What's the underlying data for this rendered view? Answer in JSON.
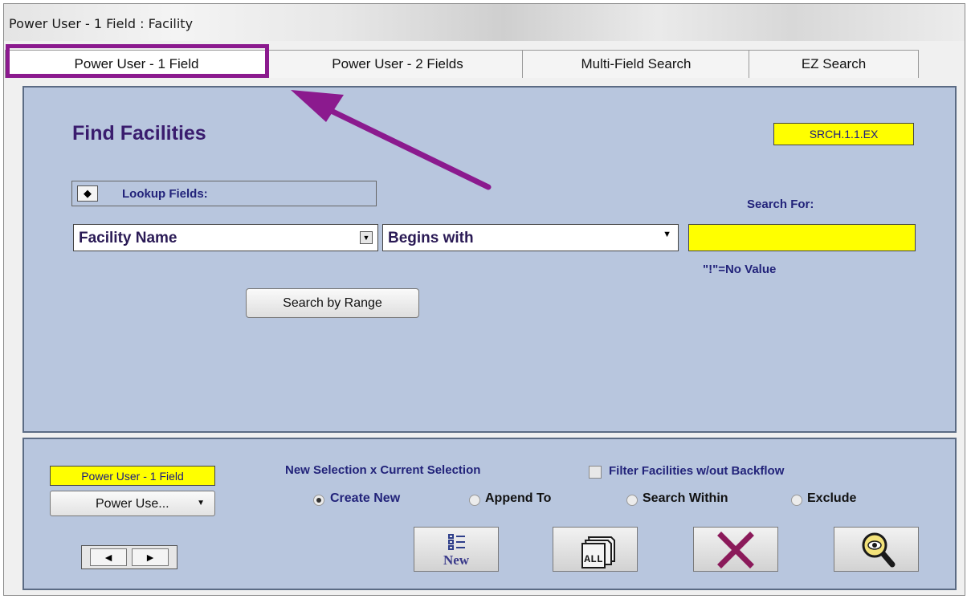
{
  "window": {
    "title": "Power User - 1 Field : Facility"
  },
  "tabs": [
    {
      "label": "Power User - 1 Field"
    },
    {
      "label": "Power User - 2 Fields"
    },
    {
      "label": "Multi-Field Search"
    },
    {
      "label": "EZ Search"
    }
  ],
  "main": {
    "title": "Find Facilities",
    "code": "SRCH.1.1.EX",
    "lookup_toggle": "◆",
    "lookup_label": "Lookup Fields:",
    "search_for_label": "Search For:",
    "field_select": "Facility Name",
    "operator_select": "Begins with",
    "search_value": "",
    "no_value_hint": "\"!\"=No Value",
    "range_button": "Search by Range"
  },
  "bottom": {
    "mode_badge": "Power User - 1 Field",
    "mode_dropdown": "Power Use...",
    "nav_prev": "◄",
    "nav_next": "►",
    "selection_label": "New Selection x Current Selection",
    "filter_label": "Filter Facilities w/out Backflow",
    "filter_checked": false,
    "radios": [
      {
        "label": "Create New",
        "checked": true
      },
      {
        "label": "Append To",
        "checked": false
      },
      {
        "label": "Search Within",
        "checked": false
      },
      {
        "label": "Exclude",
        "checked": false
      }
    ],
    "new_button": "New",
    "all_button": "ALL"
  },
  "colors": {
    "panel": "#b8c6de",
    "highlight": "#8b1a8e",
    "label_navy": "#22237a",
    "yellow": "#ffff00",
    "x_icon": "#8b1a5a"
  },
  "icons": [
    "lookup-toggle-icon",
    "dropdown-arrow-icon",
    "arrow-annotation",
    "new-list-icon",
    "all-records-icon",
    "cancel-x-icon",
    "magnifier-eye-icon"
  ]
}
